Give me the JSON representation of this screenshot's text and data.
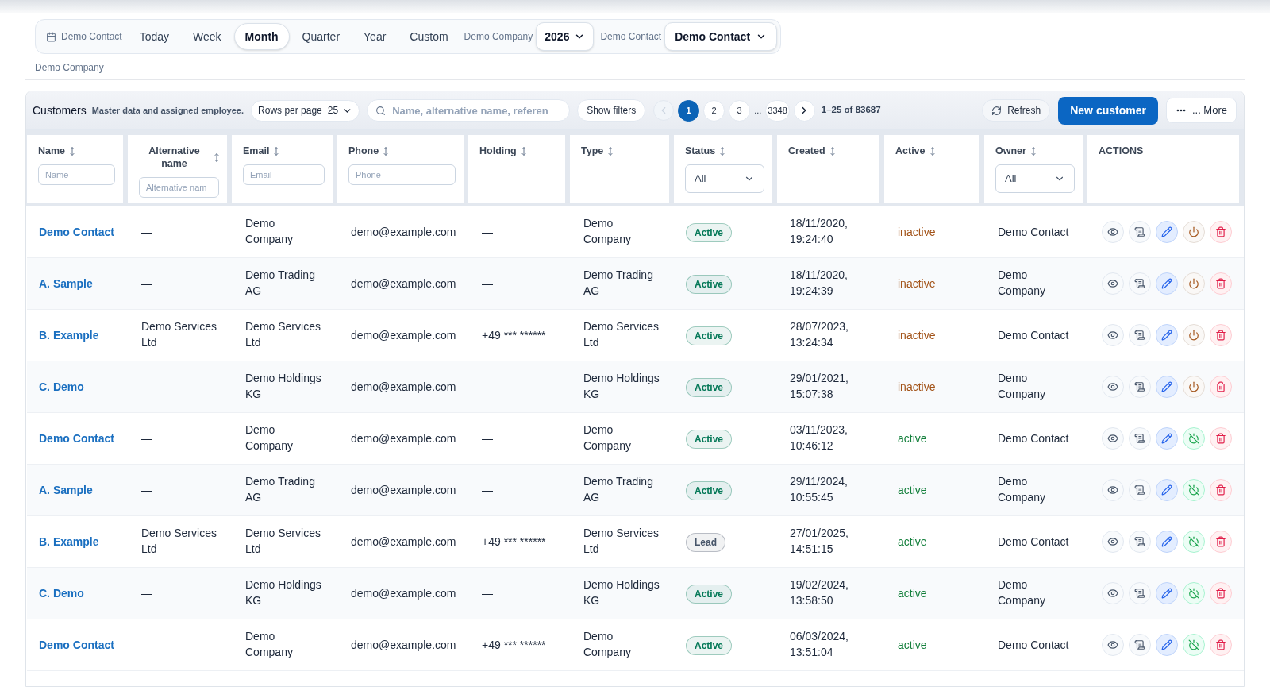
{
  "filter_bar": {
    "period_label": "Demo Contact",
    "periods": [
      {
        "label": "Today",
        "selected": false
      },
      {
        "label": "Week",
        "selected": false
      },
      {
        "label": "Month",
        "selected": true
      },
      {
        "label": "Quarter",
        "selected": false
      },
      {
        "label": "Year",
        "selected": false
      },
      {
        "label": "Custom",
        "selected": false
      }
    ],
    "year_label": "Demo Company",
    "year_select": {
      "value": "2026"
    },
    "contact_label": "Demo Contact",
    "contact_select": {
      "value": "Demo Contact"
    },
    "caption": "Demo Company"
  },
  "toolbar": {
    "title": "Customers",
    "subtitle": "Master data and assigned employee.",
    "rows_per_page": {
      "label": "Rows per page",
      "value": "25"
    },
    "search": {
      "placeholder": "Name, alternative name, referen"
    },
    "show_filters": "Show filters",
    "pagination": {
      "prev": {
        "disabled": true
      },
      "pages": [
        {
          "label": "1",
          "kind": "page",
          "selected": true
        },
        {
          "label": "2",
          "kind": "page",
          "selected": false
        },
        {
          "label": "3",
          "kind": "page",
          "selected": false
        },
        {
          "label": "...",
          "kind": "ellipsis",
          "selected": false
        },
        {
          "label": "3348",
          "kind": "page",
          "selected": false
        }
      ],
      "next": {
        "disabled": false
      },
      "range": "1–25 of 83687"
    },
    "refresh": "Refresh",
    "new_button": "New customer",
    "more_button": "... More"
  },
  "table": {
    "columns": [
      {
        "label": "Name",
        "sortable": true,
        "filter": {
          "kind": "input",
          "placeholder": "Name"
        }
      },
      {
        "label": "Alternative name",
        "sortable": true,
        "filter": {
          "kind": "input",
          "placeholder": "Alternative nam"
        }
      },
      {
        "label": "Email",
        "sortable": true,
        "filter": {
          "kind": "input",
          "placeholder": "Email"
        }
      },
      {
        "label": "Phone",
        "sortable": true,
        "filter": {
          "kind": "input",
          "placeholder": "Phone"
        }
      },
      {
        "label": "Holding",
        "sortable": true
      },
      {
        "label": "Type",
        "sortable": true
      },
      {
        "label": "Status",
        "sortable": true,
        "filter": {
          "kind": "select",
          "value": "All"
        }
      },
      {
        "label": "Created",
        "sortable": true
      },
      {
        "label": "Active",
        "sortable": true
      },
      {
        "label": "Owner",
        "sortable": true,
        "filter": {
          "kind": "select",
          "value": "All"
        }
      },
      {
        "label": "ACTIONS",
        "sortable": false
      }
    ],
    "rows": [
      {
        "cells": [
          "Demo Contact",
          "—",
          "Demo Company",
          "demo@example.com",
          "—",
          "Demo Company"
        ],
        "status": {
          "label": "Active",
          "color": "#047857"
        },
        "created": "18/11/2020, 19:24:40",
        "active": {
          "label": "inactive",
          "on": false
        },
        "owner": "Demo Contact"
      },
      {
        "cells": [
          "A. Sample",
          "—",
          "Demo Trading AG",
          "demo@example.com",
          "—",
          "Demo Trading AG"
        ],
        "status": {
          "label": "Active",
          "color": "#047857"
        },
        "created": "18/11/2020, 19:24:39",
        "active": {
          "label": "inactive",
          "on": false
        },
        "owner": "Demo Company"
      },
      {
        "cells": [
          "B. Example",
          "Demo Services Ltd",
          "Demo Services Ltd",
          "demo@example.com",
          "+49 *** ******",
          "Demo Services Ltd"
        ],
        "status": {
          "label": "Active",
          "color": "#047857"
        },
        "created": "28/07/2023, 13:24:34",
        "active": {
          "label": "inactive",
          "on": false
        },
        "owner": "Demo Contact"
      },
      {
        "cells": [
          "C. Demo",
          "—",
          "Demo Holdings KG",
          "demo@example.com",
          "—",
          "Demo Holdings KG"
        ],
        "status": {
          "label": "Active",
          "color": "#047857"
        },
        "created": "29/01/2021, 15:07:38",
        "active": {
          "label": "inactive",
          "on": false
        },
        "owner": "Demo Company"
      },
      {
        "cells": [
          "Demo Contact",
          "—",
          "Demo Company",
          "demo@example.com",
          "—",
          "Demo Company"
        ],
        "status": {
          "label": "Active",
          "color": "#047857"
        },
        "created": "03/11/2023, 10:46:12",
        "active": {
          "label": "active",
          "on": true
        },
        "owner": "Demo Contact"
      },
      {
        "cells": [
          "A. Sample",
          "—",
          "Demo Trading AG",
          "demo@example.com",
          "—",
          "Demo Trading AG"
        ],
        "status": {
          "label": "Active",
          "color": "#047857"
        },
        "created": "29/11/2024, 10:55:45",
        "active": {
          "label": "active",
          "on": true
        },
        "owner": "Demo Company"
      },
      {
        "cells": [
          "B. Example",
          "Demo Services Ltd",
          "Demo Services Ltd",
          "demo@example.com",
          "+49 *** ******",
          "Demo Services Ltd"
        ],
        "status": {
          "label": "Lead",
          "color": "#475569"
        },
        "created": "27/01/2025, 14:51:15",
        "active": {
          "label": "active",
          "on": true
        },
        "owner": "Demo Contact"
      },
      {
        "cells": [
          "C. Demo",
          "—",
          "Demo Holdings KG",
          "demo@example.com",
          "—",
          "Demo Holdings KG"
        ],
        "status": {
          "label": "Active",
          "color": "#047857"
        },
        "created": "19/02/2024, 13:58:50",
        "active": {
          "label": "active",
          "on": true
        },
        "owner": "Demo Company"
      },
      {
        "cells": [
          "Demo Contact",
          "—",
          "Demo Company",
          "demo@example.com",
          "+49 *** ******",
          "Demo Company"
        ],
        "status": {
          "label": "Active",
          "color": "#047857"
        },
        "created": "06/03/2024, 13:51:04",
        "active": {
          "label": "active",
          "on": true
        },
        "owner": "Demo Contact"
      }
    ]
  }
}
